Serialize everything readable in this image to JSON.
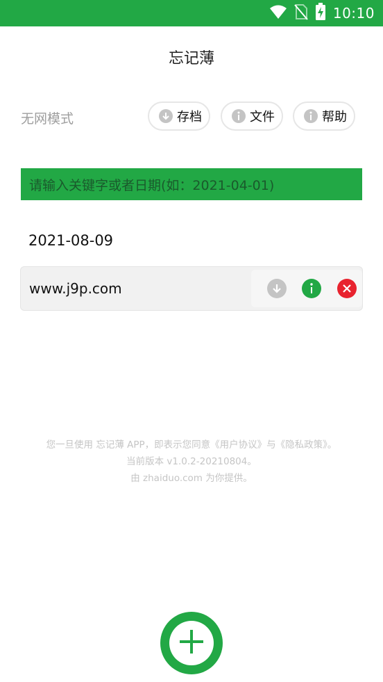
{
  "status_bar": {
    "time": "10:10",
    "icons": [
      "wifi-icon",
      "no-sim-icon",
      "battery-charging-icon"
    ]
  },
  "header": {
    "title": "忘记薄"
  },
  "toolbar": {
    "mode_label": "无网模式",
    "buttons": [
      {
        "label": "存档",
        "icon": "download-icon"
      },
      {
        "label": "文件",
        "icon": "info-icon"
      },
      {
        "label": "帮助",
        "icon": "info-icon"
      }
    ]
  },
  "search": {
    "placeholder": "请输入关键字或者日期(如：2021-04-01)"
  },
  "notes": {
    "groups": [
      {
        "date": "2021-08-09",
        "items": [
          {
            "text": "www.j9p.com",
            "actions": [
              "download-icon",
              "info-icon",
              "delete-icon"
            ]
          }
        ]
      }
    ]
  },
  "footer": {
    "line1": "您一旦使用 忘记薄 APP，即表示您同意《用户协议》与《隐私政策》。",
    "line2": "当前版本 v1.0.2-20210804。",
    "line3": "由 zhaiduo.com 为你提供。"
  },
  "fab": {
    "icon": "plus-icon"
  },
  "colors": {
    "accent": "#22a845",
    "delete": "#e8232f",
    "muted_icon": "#c4c4c4",
    "placeholder_text": "#1a5a2c"
  }
}
